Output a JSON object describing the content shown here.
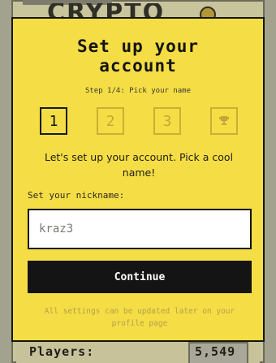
{
  "background": {
    "logo_text": "CRYPTO",
    "players_label": "Players:",
    "players_count": "5,549"
  },
  "modal": {
    "title": "Set up your\naccount",
    "step_label": "Step 1/4: Pick your name",
    "steps": [
      {
        "label": "1",
        "active": true
      },
      {
        "label": "2",
        "active": false
      },
      {
        "label": "3",
        "active": false
      },
      {
        "icon": "trophy-icon",
        "active": false
      }
    ],
    "intro": "Let's set up your account. Pick a cool name!",
    "nickname_label": "Set your nickname:",
    "nickname_value": "kraz3",
    "continue_label": "Continue",
    "footnote": "All settings can be updated later on your profile page"
  },
  "colors": {
    "modal_bg": "#f5dd45",
    "border": "#151510",
    "button_bg": "#141414",
    "inactive_step": "#c8b036"
  }
}
